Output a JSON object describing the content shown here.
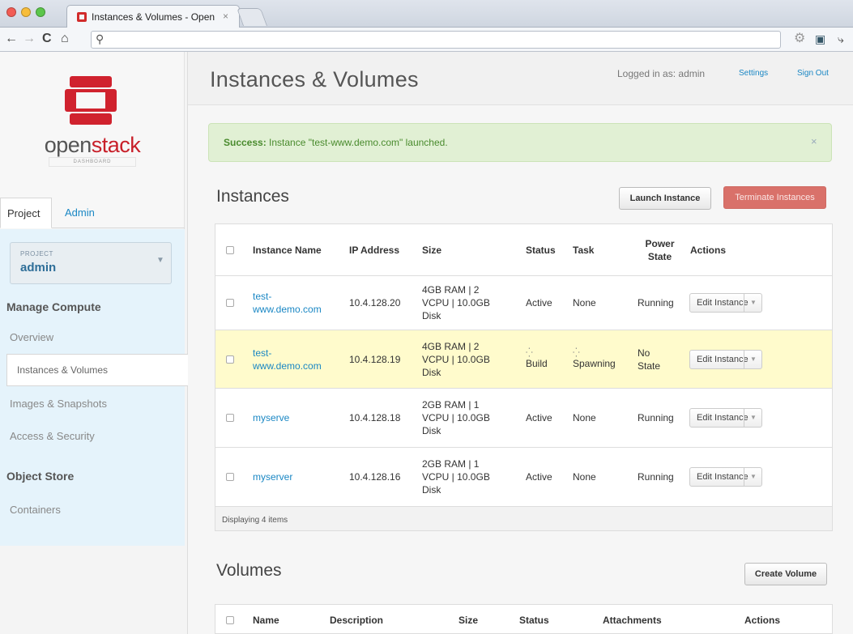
{
  "browser": {
    "tab_title": "Instances & Volumes - Open",
    "tab_close": "×",
    "url": ""
  },
  "sidebar": {
    "logo_text_a": "open",
    "logo_text_b": "stack",
    "logo_subtitle": "DASHBOARD",
    "tabs": [
      "Project",
      "Admin"
    ],
    "project_label": "PROJECT",
    "project_name": "admin",
    "sections": [
      {
        "title": "Manage Compute",
        "items": [
          "Overview",
          "Instances & Volumes",
          "Images & Snapshots",
          "Access & Security"
        ]
      },
      {
        "title": "Object Store",
        "items": [
          "Containers"
        ]
      }
    ],
    "active_item": "Instances & Volumes"
  },
  "header": {
    "title": "Instances & Volumes",
    "logged_in": "Logged in as: admin",
    "settings": "Settings",
    "sign_out": "Sign Out"
  },
  "alert": {
    "strong": "Success:",
    "message": " Instance \"test-www.demo.com\" launched.",
    "close": "×"
  },
  "instances": {
    "title": "Instances",
    "launch_button": "Launch Instance",
    "terminate_button": "Terminate Instances",
    "columns": [
      "Instance Name",
      "IP Address",
      "Size",
      "Status",
      "Task",
      "Power State",
      "Actions"
    ],
    "rows": [
      {
        "name": "test-www.demo.com",
        "ip": "10.4.128.20",
        "size": "4GB RAM | 2 VCPU | 10.0GB Disk",
        "status": "Active",
        "task": "None",
        "power": "Running",
        "action": "Edit Instance",
        "highlight": false
      },
      {
        "name": "test-www.demo.com",
        "ip": "10.4.128.19",
        "size": "4GB RAM | 2 VCPU | 10.0GB Disk",
        "status": "Build",
        "task": "Spawning",
        "power": "No State",
        "action": "Edit Instance",
        "highlight": true
      },
      {
        "name": "myserve",
        "ip": "10.4.128.18",
        "size": "2GB RAM | 1 VCPU | 10.0GB Disk",
        "status": "Active",
        "task": "None",
        "power": "Running",
        "action": "Edit Instance",
        "highlight": false
      },
      {
        "name": "myserver",
        "ip": "10.4.128.16",
        "size": "2GB RAM | 1 VCPU | 10.0GB Disk",
        "status": "Active",
        "task": "None",
        "power": "Running",
        "action": "Edit Instance",
        "highlight": false
      }
    ],
    "footer": "Displaying 4 items"
  },
  "volumes": {
    "title": "Volumes",
    "create_button": "Create Volume",
    "columns": [
      "Name",
      "Description",
      "Size",
      "Status",
      "Attachments",
      "Actions"
    ]
  },
  "colors": {
    "link": "#1a87c4",
    "brand": "#c8202a",
    "success_bg": "#e1f0d4",
    "danger": "#d9716a"
  }
}
